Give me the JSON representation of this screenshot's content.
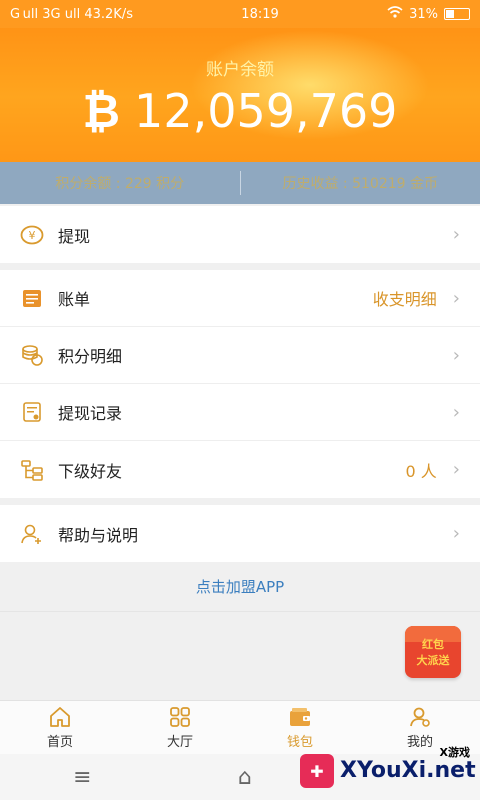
{
  "status": {
    "left": "G ull 3G ull 43.2K/s",
    "time": "18:19",
    "battery": "31%"
  },
  "hero": {
    "title": "账户余额",
    "amount": "12,059,769",
    "icon": "bitcoin-icon"
  },
  "stats": {
    "left": "积分余额 : 229 积分",
    "right": "历史收益 : 510219 金币"
  },
  "menu": {
    "withdraw": {
      "label": "提现",
      "icon": "yuan-coin-icon"
    },
    "bill": {
      "label": "账单",
      "value": "收支明细",
      "icon": "ledger-icon"
    },
    "points": {
      "label": "积分明细",
      "icon": "coins-stack-icon"
    },
    "withdraw_history": {
      "label": "提现记录",
      "icon": "receipt-icon"
    },
    "subordinates": {
      "label": "下级好友",
      "value": "0 人",
      "icon": "tree-icon"
    },
    "help": {
      "label": "帮助与说明",
      "icon": "user-plus-icon"
    }
  },
  "join_link": "点击加盟APP",
  "redpacket": {
    "line1": "红包",
    "line2": "大派送"
  },
  "tabs": [
    {
      "label": "首页",
      "icon": "home-icon"
    },
    {
      "label": "大厅",
      "icon": "grid-icon"
    },
    {
      "label": "钱包",
      "icon": "wallet-icon"
    },
    {
      "label": "我的",
      "icon": "profile-icon"
    }
  ],
  "watermark": {
    "brand": "XYouXi.net",
    "sub": "X游戏"
  },
  "colors": {
    "accent": "#ff9a1f",
    "gold": "#d99a2e",
    "link": "#3c7fbf"
  }
}
